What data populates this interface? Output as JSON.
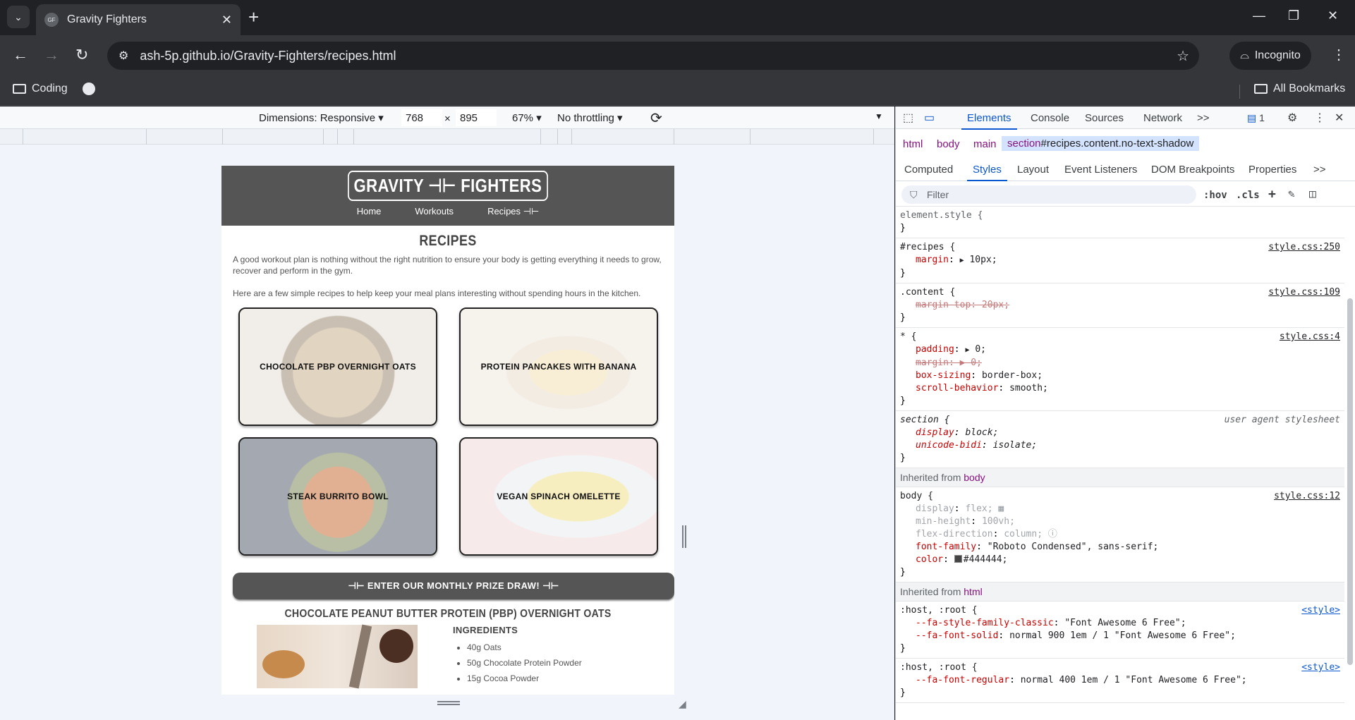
{
  "browser": {
    "tab_title": "Gravity Fighters",
    "url": "ash-5p.github.io/Gravity-Fighters/recipes.html",
    "incognito_label": "Incognito",
    "bookmarks": {
      "coding": "Coding",
      "all_bookmarks": "All Bookmarks"
    }
  },
  "emulation": {
    "dimensions_label": "Dimensions: Responsive",
    "width": "768",
    "times": "×",
    "height": "895",
    "zoom": "67%",
    "throttling": "No throttling"
  },
  "site": {
    "logo": "GRAVITY ⊣⊢ FIGHTERS",
    "nav": {
      "home": "Home",
      "workouts": "Workouts",
      "recipes": "Recipes ⊣⊢"
    },
    "page_title": "RECIPES",
    "intro_1": "A good workout plan is nothing without the right nutrition to ensure your body is getting everything it needs to grow, recover and perform in the gym.",
    "intro_2": "Here are a few simple recipes to help keep your meal plans interesting without spending hours in the kitchen.",
    "cards": [
      {
        "label": "CHOCOLATE PBP OVERNIGHT OATS"
      },
      {
        "label": "PROTEIN PANCAKES WITH BANANA"
      },
      {
        "label": "STEAK BURRITO BOWL"
      },
      {
        "label": "VEGAN SPINACH OMELETTE"
      }
    ],
    "prize_button": "⊣⊢ ENTER OUR MONTHLY PRIZE DRAW! ⊣⊢",
    "recipe_title": "CHOCOLATE PEANUT BUTTER PROTEIN (PBP) OVERNIGHT OATS",
    "ingredients_heading": "INGREDIENTS",
    "ingredients": [
      "40g Oats",
      "50g Chocolate Protein Powder",
      "15g Cocoa Powder"
    ]
  },
  "devtools": {
    "tabs": {
      "elements": "Elements",
      "console": "Console",
      "sources": "Sources",
      "network": "Network",
      "more": ">>",
      "issues_count": "1"
    },
    "breadcrumbs": {
      "html": "html",
      "body": "body",
      "main": "main",
      "section_tag": "section",
      "section_rest": "#recipes.content.no-text-shadow"
    },
    "sub_tabs": {
      "computed": "Computed",
      "styles": "Styles",
      "layout": "Layout",
      "event_listeners": "Event Listeners",
      "dom_breakpoints": "DOM Breakpoints",
      "properties": "Properties",
      "more": ">>"
    },
    "filter_placeholder": "Filter",
    "hov": ":hov",
    "cls": ".cls",
    "rules": {
      "element_style": "element.style {",
      "close": "}",
      "recipes_sel": "#recipes {",
      "recipes_src": "style.css:250",
      "recipes_prop": "margin",
      "recipes_val": "10px;",
      "content_sel": ".content {",
      "content_src": "style.css:109",
      "content_decl": "margin-top: 20px;",
      "star_sel": "* {",
      "star_src": "style.css:4",
      "padding_prop": "padding",
      "padding_val": "0;",
      "margin_struck": "margin: ▶ 0;",
      "box_prop": "box-sizing",
      "box_val": "border-box;",
      "scroll_prop": "scroll-behavior",
      "scroll_val": "smooth;",
      "section_sel": "section {",
      "section_src": "user agent stylesheet",
      "display_prop": "display",
      "display_val": "block;",
      "bidi_prop": "unicode-bidi",
      "bidi_val": "isolate;",
      "inherited_from": "Inherited from",
      "inherited_body": "body",
      "body_sel": "body {",
      "body_src": "style.css:12",
      "flex_prop": "display",
      "flex_val": "flex;",
      "minh_prop": "min-height",
      "minh_val": "100vh;",
      "fdir_prop": "flex-direction",
      "fdir_val": "column;",
      "ff_prop": "font-family",
      "ff_val": "\"Roboto Condensed\", sans-serif;",
      "color_prop": "color",
      "color_val": "#444444;",
      "color_swatch": "#444444",
      "inherited_html": "html",
      "root_sel": ":host, :root {",
      "root_src": "<style>",
      "fa_family_prop": "--fa-style-family-classic",
      "fa_family_val": "\"Font Awesome 6 Free\";",
      "fa_solid_prop": "--fa-font-solid",
      "fa_solid_val": "normal 900 1em / 1 \"Font Awesome 6 Free\";",
      "root2_sel": ":host, :root {",
      "root2_src": "<style>",
      "fa_regular_prop": "--fa-font-regular",
      "fa_regular_val": "normal 400 1em / 1 \"Font Awesome 6 Free\";"
    }
  }
}
